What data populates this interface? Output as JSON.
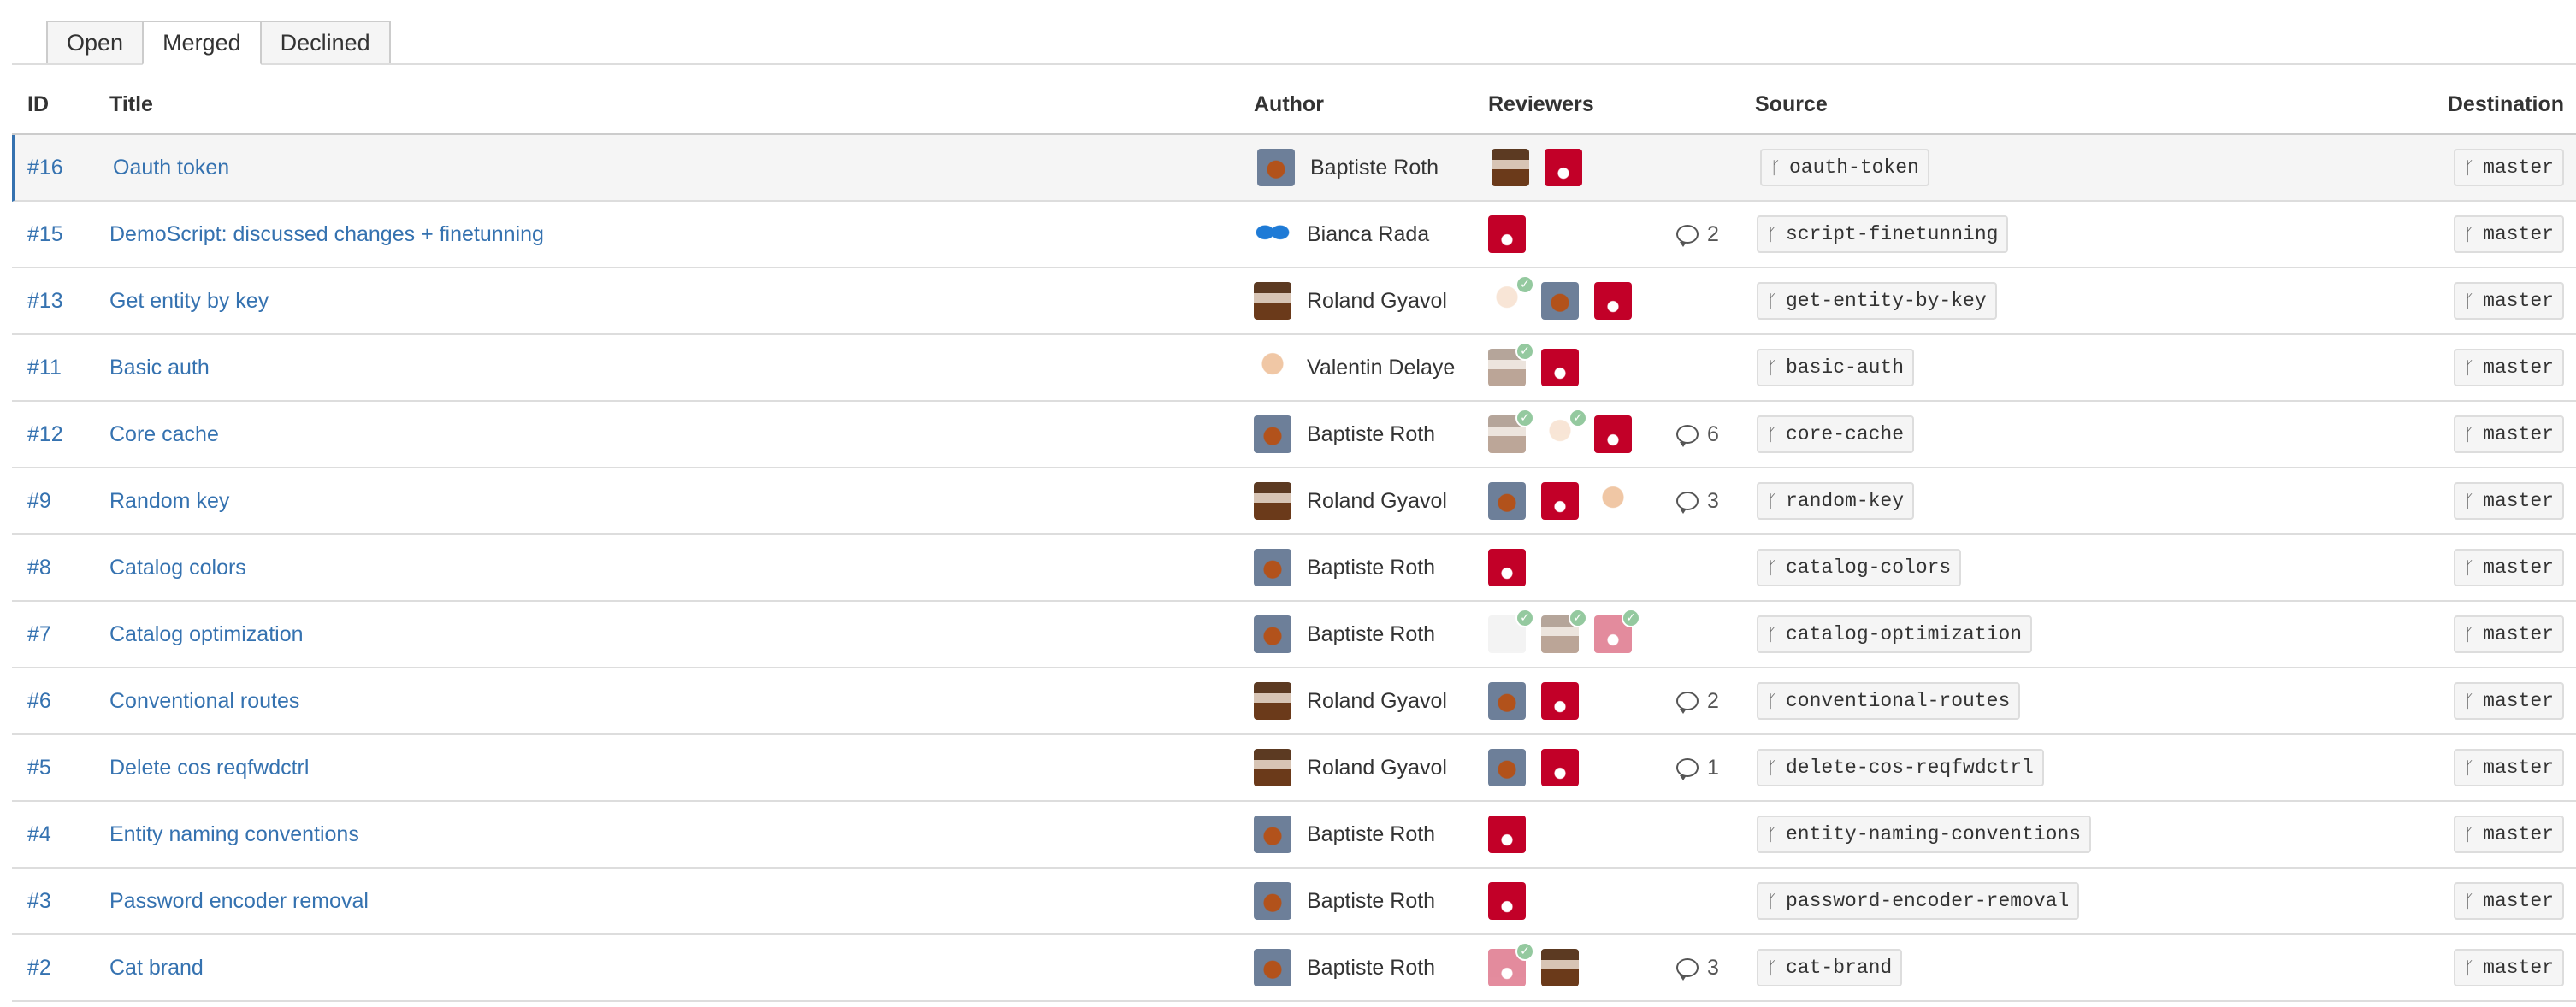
{
  "tabs": [
    {
      "label": "Open"
    },
    {
      "label": "Merged"
    },
    {
      "label": "Declined"
    }
  ],
  "headers": {
    "id": "ID",
    "title": "Title",
    "author": "Author",
    "reviewers": "Reviewers",
    "source": "Source",
    "destination": "Destination"
  },
  "rows": [
    {
      "id": "#16",
      "title": "Oauth token",
      "author": "Baptiste Roth",
      "comments": "",
      "source": "oauth-token",
      "destination": "master"
    },
    {
      "id": "#15",
      "title": "DemoScript: discussed changes + finetunning",
      "author": "Bianca Rada",
      "comments": "2",
      "source": "script-finetunning",
      "destination": "master"
    },
    {
      "id": "#13",
      "title": "Get entity by key",
      "author": "Roland Gyavol",
      "comments": "",
      "source": "get-entity-by-key",
      "destination": "master"
    },
    {
      "id": "#11",
      "title": "Basic auth",
      "author": "Valentin Delaye",
      "comments": "",
      "source": "basic-auth",
      "destination": "master"
    },
    {
      "id": "#12",
      "title": "Core cache",
      "author": "Baptiste Roth",
      "comments": "6",
      "source": "core-cache",
      "destination": "master"
    },
    {
      "id": "#9",
      "title": "Random key",
      "author": "Roland Gyavol",
      "comments": "3",
      "source": "random-key",
      "destination": "master"
    },
    {
      "id": "#8",
      "title": "Catalog colors",
      "author": "Baptiste Roth",
      "comments": "",
      "source": "catalog-colors",
      "destination": "master"
    },
    {
      "id": "#7",
      "title": "Catalog optimization",
      "author": "Baptiste Roth",
      "comments": "",
      "source": "catalog-optimization",
      "destination": "master"
    },
    {
      "id": "#6",
      "title": "Conventional routes",
      "author": "Roland Gyavol",
      "comments": "2",
      "source": "conventional-routes",
      "destination": "master"
    },
    {
      "id": "#5",
      "title": "Delete cos reqfwdctrl",
      "author": "Roland Gyavol",
      "comments": "1",
      "source": "delete-cos-reqfwdctrl",
      "destination": "master"
    },
    {
      "id": "#4",
      "title": "Entity naming conventions",
      "author": "Baptiste Roth",
      "comments": "",
      "source": "entity-naming-conventions",
      "destination": "master"
    },
    {
      "id": "#3",
      "title": "Password encoder removal",
      "author": "Baptiste Roth",
      "comments": "",
      "source": "password-encoder-removal",
      "destination": "master"
    },
    {
      "id": "#2",
      "title": "Cat brand",
      "author": "Baptiste Roth",
      "comments": "3",
      "source": "cat-brand",
      "destination": "master"
    }
  ],
  "icons": {
    "branch": "branch-icon",
    "comment": "comment-icon",
    "approved": "check-icon"
  },
  "colors": {
    "link": "#3572b0",
    "approved": "#14892c",
    "active_row_border": "#3572b0"
  }
}
